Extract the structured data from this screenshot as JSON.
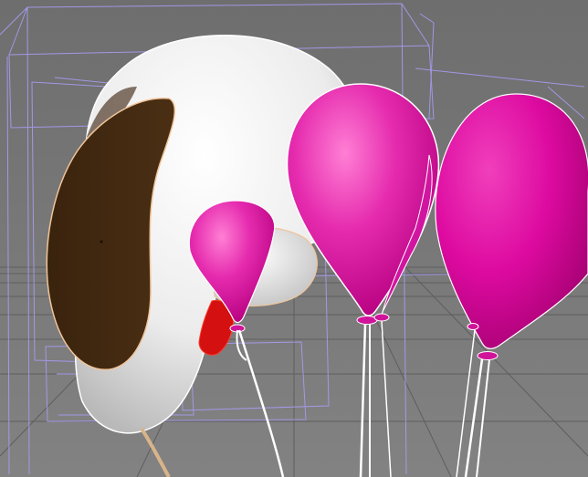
{
  "viewport": {
    "background_top": "#6f6f6f",
    "background_bottom": "#808080",
    "grid_color": "#5d5d5d",
    "wireframe_color": "#a79cf2",
    "selection_outline_color": "#ffffff"
  },
  "scene": {
    "head_color": "#f4f4f4",
    "ear_color": "#432a11",
    "ear_edge_color": "#f0c49a",
    "tongue_color": "#d41010",
    "balloon_color": "#e81ea8",
    "balloon_highlight": "#ff7fd4",
    "string_color": "#ffffff"
  }
}
